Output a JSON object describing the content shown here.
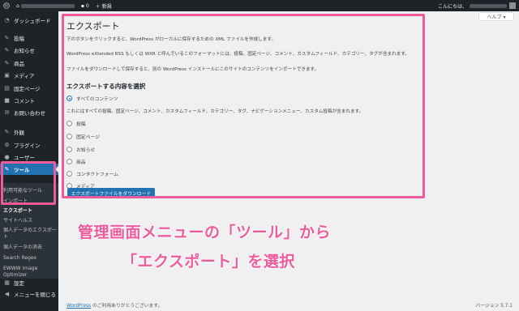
{
  "adminbar": {
    "comments_count": "0",
    "new_label": "＋ 新規",
    "greeting": "こんにちは、"
  },
  "sidebar": {
    "items": [
      {
        "icon": "dashboard-icon",
        "label": "ダッシュボード"
      },
      {
        "icon": "pin-icon",
        "label": "投稿"
      },
      {
        "icon": "pin-icon",
        "label": "お知らせ"
      },
      {
        "icon": "pin-icon",
        "label": "商品"
      },
      {
        "icon": "media-icon",
        "label": "メディア"
      },
      {
        "icon": "page-icon",
        "label": "固定ページ"
      },
      {
        "icon": "comment-icon",
        "label": "コメント"
      },
      {
        "icon": "mail-icon",
        "label": "お問い合わせ"
      },
      {
        "icon": "brush-icon",
        "label": "外観"
      },
      {
        "icon": "plugin-icon",
        "label": "プラグイン"
      },
      {
        "icon": "user-icon",
        "label": "ユーザー"
      },
      {
        "icon": "wrench-icon",
        "label": "ツール"
      }
    ],
    "submenu": [
      "利用可能なツール",
      "インポート",
      "エクスポート",
      "サイトヘルス",
      "個人データのエクスポート",
      "個人データの消去",
      "Search Regex",
      "EWWW Image Optimizer"
    ],
    "settings_label": "設定",
    "collapse_label": "メニューを閉じる"
  },
  "main": {
    "help_label": "ヘルプ ▾",
    "title": "エクスポート",
    "intro1": "下のボタンをクリックすると、WordPress がローカルに保存するための XML ファイルを作成します。",
    "intro2": "WordPress eXtended RSS もしくは WXR と呼んでいるこのフォーマットには、投稿、固定ページ、コメント、カスタムフィールド、カテゴリー、タグが含まれます。",
    "intro3": "ファイルをダウンロードして保存すると、別の WordPress インストールにこのサイトのコンテンツをインポートできます。",
    "choose_heading": "エクスポートする内容を選択",
    "all_content_label": "すべてのコンテンツ",
    "all_content_desc": "これにはすべての投稿、固定ページ、コメント、カスタムフィールド、カテゴリー、タグ、ナビゲーションメニュー、カスタム投稿が含まれます。",
    "options": [
      "投稿",
      "固定ページ",
      "お知らせ",
      "商品",
      "コンタクトフォーム",
      "メディア"
    ],
    "download_button": "エクスポートファイルをダウンロード",
    "footer_link": "WordPress",
    "footer_text": " のご利用ありがとうございます。",
    "version": "バージョン 5.7.1"
  },
  "annotation": {
    "line1": "管理画面メニューの「ツール」から",
    "line2": "「エクスポート」を選択"
  },
  "colors": {
    "highlight": "#ef5a9c",
    "accent": "#2271b1",
    "sidebar_bg": "#1d2327"
  }
}
